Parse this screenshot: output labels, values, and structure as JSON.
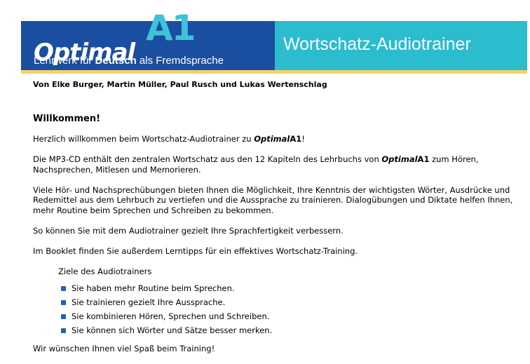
{
  "banner": {
    "logo_word": "Optimal",
    "logo_level": "A1",
    "subtitle_pre": "Lehrwerk für ",
    "subtitle_bold": "Deutsch",
    "subtitle_post": " als Fremdsprache",
    "title": "Wortschatz-Audiotrainer",
    "colors": {
      "left": "#1a4ea0",
      "right": "#2bbccd",
      "stripe": "#f2d36b",
      "a1": "#3cc3d8"
    }
  },
  "authors": "Von Elke Burger, Martin Müller, Paul Rusch und Lukas Wertenschlag",
  "content": {
    "heading": "Willkommen!",
    "p1_pre": "Herzlich willkommen beim Wortschatz-Audiotrainer zu ",
    "p1_post": "!",
    "p2_pre": "Die MP3-CD enthält den zentralen Wortschatz aus den 12 Kapiteln des Lehrbuchs von ",
    "p2_post": " zum Hören, Nachsprechen, Mitlesen und Memorieren.",
    "p3": "Viele Hör- und Nachsprechübungen bieten Ihnen die Möglichkeit, Ihre Kenntnis der wichtigsten Wörter, Ausdrücke und Redemittel aus dem Lehrbuch zu vertiefen und die Aussprache zu trainieren. Dialogübungen und Diktate helfen Ihnen, mehr Routine beim Sprechen und Schreiben zu bekommen.",
    "p4": "So können Sie mit dem Audiotrainer gezielt Ihre Sprachfertigkeit verbessern.",
    "p5": "Im Booklet finden Sie außerdem Lerntipps für ein effektives Wortschatz-Training.",
    "goals_title": "Ziele des Audiotrainers",
    "goals": [
      "Sie haben mehr Routine beim Sprechen.",
      "Sie trainieren gezielt Ihre Aussprache.",
      "Sie kombinieren Hören, Sprechen und Schreiben.",
      "Sie können sich Wörter und Sätze besser merken."
    ],
    "closing": "Wir wünschen Ihnen viel Spaß beim Training!",
    "brand_word": "Optimal",
    "brand_level": "A1"
  }
}
